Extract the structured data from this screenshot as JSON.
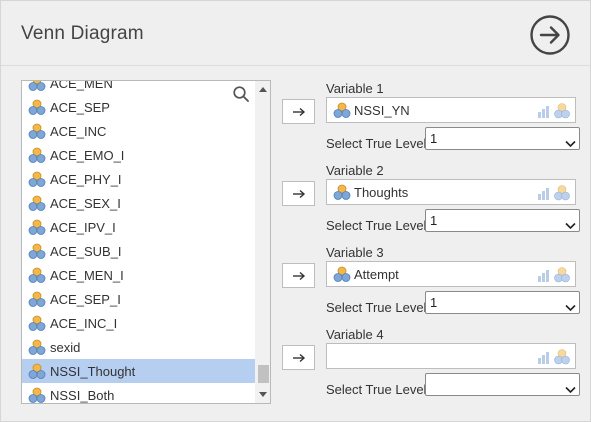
{
  "header": {
    "title": "Venn Diagram",
    "run_icon": "circle-arrow-right-icon"
  },
  "variable_list": {
    "search_icon": "magnifier-icon",
    "items": [
      {
        "label": "ACE_MEN",
        "selected": false
      },
      {
        "label": "ACE_SEP",
        "selected": false
      },
      {
        "label": "ACE_INC",
        "selected": false
      },
      {
        "label": "ACE_EMO_I",
        "selected": false
      },
      {
        "label": "ACE_PHY_I",
        "selected": false
      },
      {
        "label": "ACE_SEX_I",
        "selected": false
      },
      {
        "label": "ACE_IPV_I",
        "selected": false
      },
      {
        "label": "ACE_SUB_I",
        "selected": false
      },
      {
        "label": "ACE_MEN_I",
        "selected": false
      },
      {
        "label": "ACE_SEP_I",
        "selected": false
      },
      {
        "label": "ACE_INC_I",
        "selected": false
      },
      {
        "label": "sexid",
        "selected": false
      },
      {
        "label": "NSSI_Thought",
        "selected": true
      },
      {
        "label": "NSSI_Both",
        "selected": false
      }
    ]
  },
  "targets": [
    {
      "title": "Variable 1",
      "value": "NSSI_YN",
      "level_label": "Select True Level",
      "level_value": "1"
    },
    {
      "title": "Variable 2",
      "value": "Thoughts",
      "level_label": "Select True Level",
      "level_value": "1"
    },
    {
      "title": "Variable 3",
      "value": "Attempt",
      "level_label": "Select True Level",
      "level_value": "1"
    },
    {
      "title": "Variable 4",
      "value": "",
      "level_label": "Select True Level",
      "level_value": ""
    }
  ],
  "colors": {
    "selected_row": "#b6cef0",
    "panel_bg": "#efefef",
    "icon_orange": "#f4b84a",
    "icon_blue": "#7ea7d8"
  }
}
